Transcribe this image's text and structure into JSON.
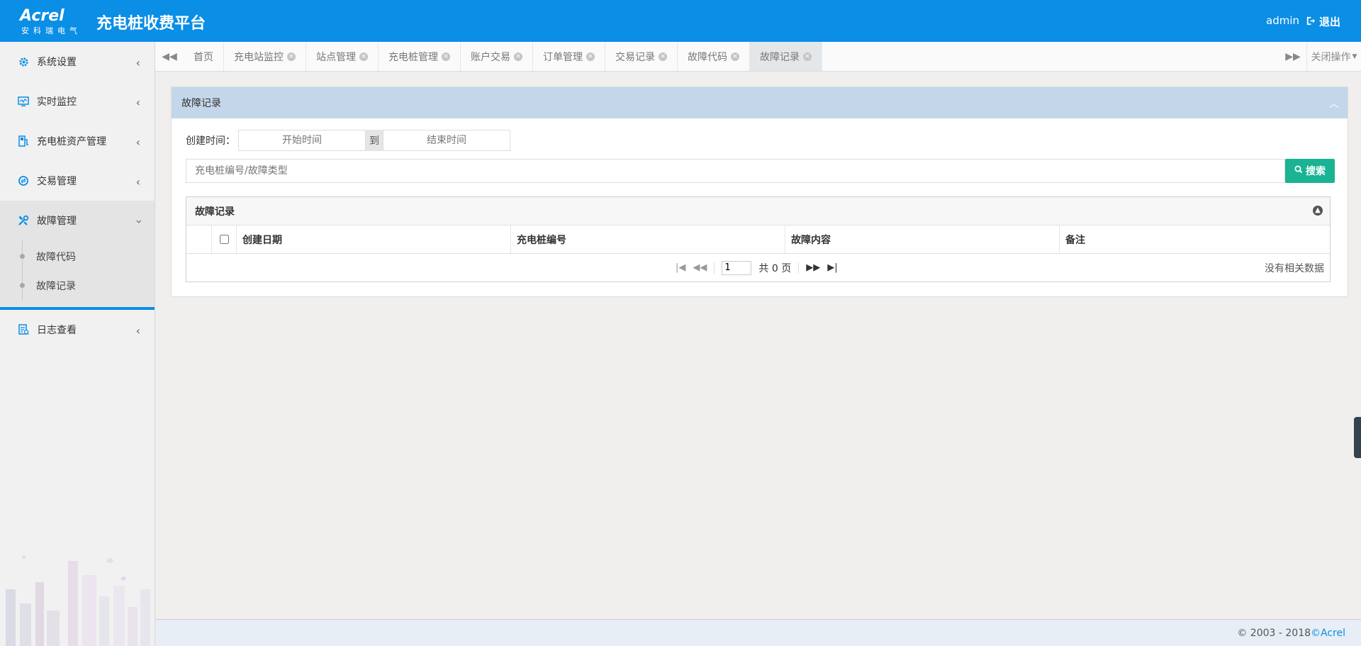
{
  "header": {
    "logo_brand": "Acrel",
    "logo_sub": "安科瑞电气",
    "app_title": "充电桩收费平台",
    "user": "admin",
    "logout_label": "退出"
  },
  "sidebar": {
    "items": [
      {
        "label": "系统设置",
        "icon": "gear-icon"
      },
      {
        "label": "实时监控",
        "icon": "monitor-icon"
      },
      {
        "label": "充电桩资产管理",
        "icon": "charger-icon"
      },
      {
        "label": "交易管理",
        "icon": "exchange-icon"
      },
      {
        "label": "故障管理",
        "icon": "tools-icon",
        "expanded": true,
        "children": [
          {
            "label": "故障代码"
          },
          {
            "label": "故障记录"
          }
        ]
      },
      {
        "label": "日志查看",
        "icon": "log-icon"
      }
    ]
  },
  "tabs": [
    {
      "label": "首页",
      "closable": false
    },
    {
      "label": "充电站监控",
      "closable": true
    },
    {
      "label": "站点管理",
      "closable": true
    },
    {
      "label": "充电桩管理",
      "closable": true
    },
    {
      "label": "账户交易",
      "closable": true
    },
    {
      "label": "订单管理",
      "closable": true
    },
    {
      "label": "交易记录",
      "closable": true
    },
    {
      "label": "故障代码",
      "closable": true
    },
    {
      "label": "故障记录",
      "closable": true,
      "active": true
    }
  ],
  "close_ops_label": "关闭操作",
  "panel": {
    "title": "故障记录",
    "created_time_label": "创建时间：",
    "start_placeholder": "开始时间",
    "range_sep": "到",
    "end_placeholder": "结束时间",
    "search_placeholder": "充电桩编号/故障类型",
    "search_button": "搜索"
  },
  "grid": {
    "title": "故障记录",
    "columns": [
      "创建日期",
      "充电桩编号",
      "故障内容",
      "备注"
    ],
    "rows": [],
    "pager": {
      "page": "1",
      "total_text": "共 0 页",
      "empty_text": "没有相关数据"
    }
  },
  "footer": {
    "copyright": "© 2003 - 2018 ",
    "brand": "©Acrel"
  },
  "colors": {
    "primary": "#0a8ee6",
    "accent": "#1ab394",
    "panel_head": "#c4d7ea"
  }
}
